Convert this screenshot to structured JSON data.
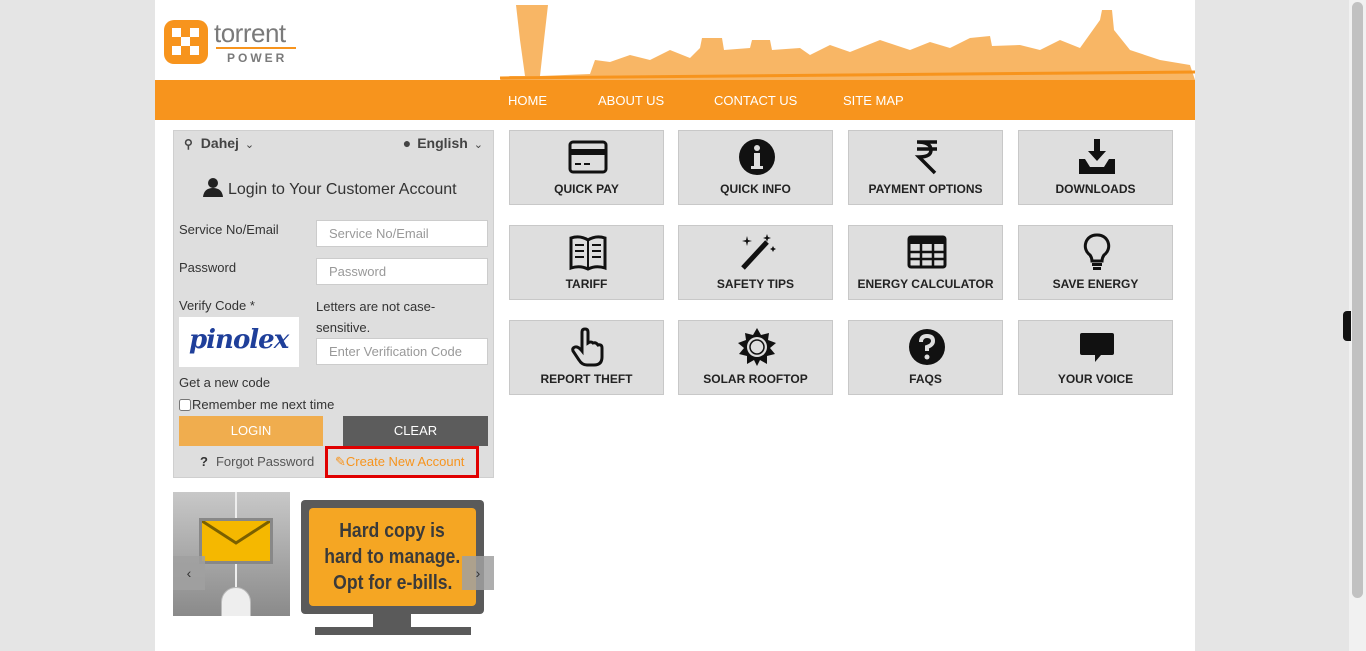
{
  "brand": {
    "name_top": "torrent",
    "name_bottom": "POWER"
  },
  "nav": {
    "items": [
      "HOME",
      "ABOUT US",
      "CONTACT US",
      "SITE MAP"
    ]
  },
  "login": {
    "location": "Dahej",
    "language": "English",
    "title": "Login to Your Customer Account",
    "service_label": "Service No/Email",
    "service_placeholder": "Service No/Email",
    "password_label": "Password",
    "password_placeholder": "Password",
    "verify_label": "Verify Code *",
    "hint": "Letters are not case-sensitive.",
    "captcha_text": "pinolex",
    "verify_placeholder": "Enter Verification Code",
    "new_code": "Get a new code",
    "remember": "Remember me next time",
    "login_btn": "LOGIN",
    "clear_btn": "CLEAR",
    "forgot": "Forgot Password",
    "create": "Create New Account"
  },
  "banner": {
    "line1": "Hard copy is",
    "line2": "hard to manage.",
    "line3": "Opt for e-bills."
  },
  "tiles": [
    {
      "label": "QUICK PAY",
      "icon": "card-icon"
    },
    {
      "label": "QUICK INFO",
      "icon": "info-icon"
    },
    {
      "label": "PAYMENT OPTIONS",
      "icon": "rupee-icon"
    },
    {
      "label": "DOWNLOADS",
      "icon": "download-icon"
    },
    {
      "label": "TARIFF",
      "icon": "book-icon"
    },
    {
      "label": "SAFETY TIPS",
      "icon": "magic-wand-icon"
    },
    {
      "label": "ENERGY CALCULATOR",
      "icon": "table-icon"
    },
    {
      "label": "SAVE ENERGY",
      "icon": "bulb-icon"
    },
    {
      "label": "REPORT THEFT",
      "icon": "hand-pointer-icon"
    },
    {
      "label": "SOLAR ROOFTOP",
      "icon": "sun-icon"
    },
    {
      "label": "FAQS",
      "icon": "question-icon"
    },
    {
      "label": "YOUR VOICE",
      "icon": "chat-icon"
    }
  ]
}
